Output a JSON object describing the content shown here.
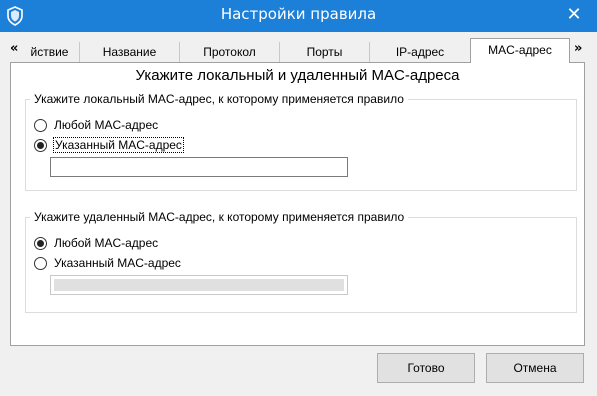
{
  "window": {
    "title": "Настройки правила",
    "close_glyph": "✕",
    "accent_color": "#1c7fd8"
  },
  "tabs": {
    "scroll_left_glyph": "«",
    "scroll_right_glyph": "»",
    "items": [
      {
        "label": "йствие"
      },
      {
        "label": "Название"
      },
      {
        "label": "Протокол"
      },
      {
        "label": "Порты"
      },
      {
        "label": "IP-адрес"
      },
      {
        "label": "MAC-адрес",
        "active": true
      }
    ]
  },
  "panel": {
    "heading": "Укажите локальный и удаленный MAC-адреса",
    "local": {
      "legend": "Укажите локальный MAC-адрес, к которому применяется правило",
      "option_any": "Любой MAC-адрес",
      "option_specified": "Указанный MAC-адрес",
      "selected": "specified",
      "mac_value": ""
    },
    "remote": {
      "legend": "Укажите удаленный MAC-адрес, к которому применяется правило",
      "option_any": "Любой MAC-адрес",
      "option_specified": "Указанный MAC-адрес",
      "selected": "any",
      "mac_value": ""
    }
  },
  "buttons": {
    "ok_label": "Готово",
    "cancel_label": "Отмена"
  }
}
